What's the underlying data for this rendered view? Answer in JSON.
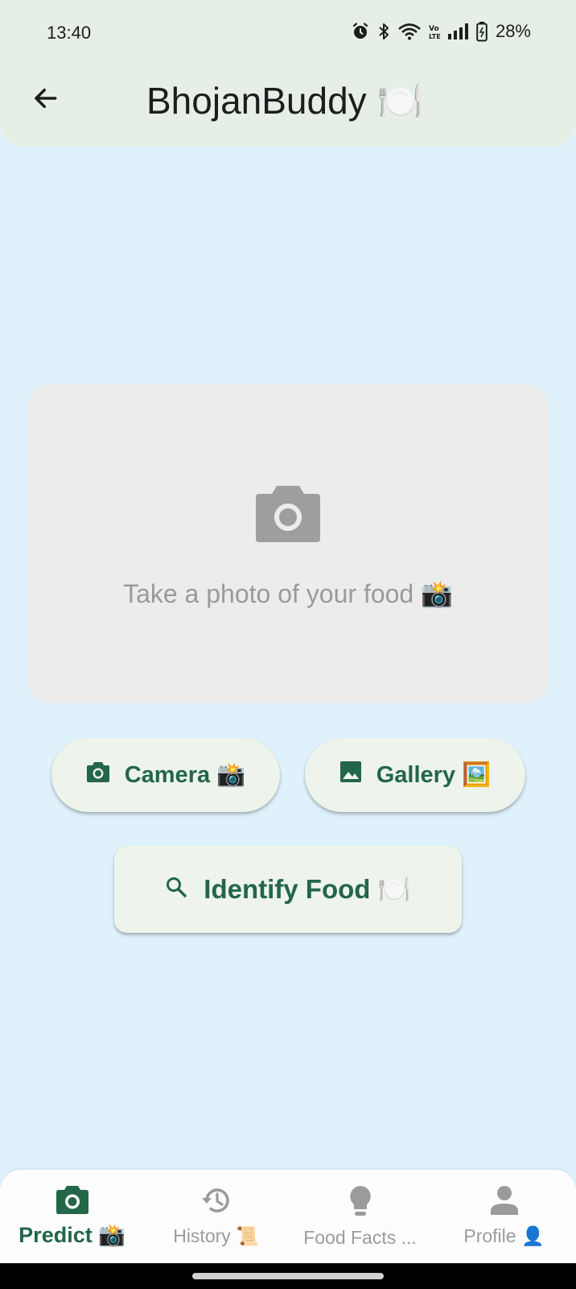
{
  "status_bar": {
    "time": "13:40",
    "battery": "28%",
    "icons": [
      "alarm-icon",
      "bluetooth-icon",
      "wifi-icon",
      "volte-icon",
      "signal-icon",
      "battery-icon"
    ]
  },
  "app_bar": {
    "title": "BhojanBuddy 🍽️",
    "back_icon": "arrow-back-icon"
  },
  "photo_placeholder": {
    "icon": "camera-icon",
    "hint": "Take a photo of your food 📸"
  },
  "buttons": {
    "camera": "Camera 📸",
    "gallery": "Gallery 🖼️",
    "identify": "Identify Food 🍽️"
  },
  "bottom_nav": {
    "items": [
      {
        "label": "Predict 📸",
        "icon": "camera-icon",
        "active": true
      },
      {
        "label": "History 📜",
        "icon": "history-icon",
        "active": false
      },
      {
        "label": "Food Facts ...",
        "icon": "lightbulb-icon",
        "active": false
      },
      {
        "label": "Profile 👤",
        "icon": "person-icon",
        "active": false
      }
    ]
  },
  "colors": {
    "accent": "#236649",
    "background": "#dff2fc",
    "app_bar": "#e6efe6",
    "button_bg": "#eef4ec",
    "inactive": "#9b9b9b"
  }
}
